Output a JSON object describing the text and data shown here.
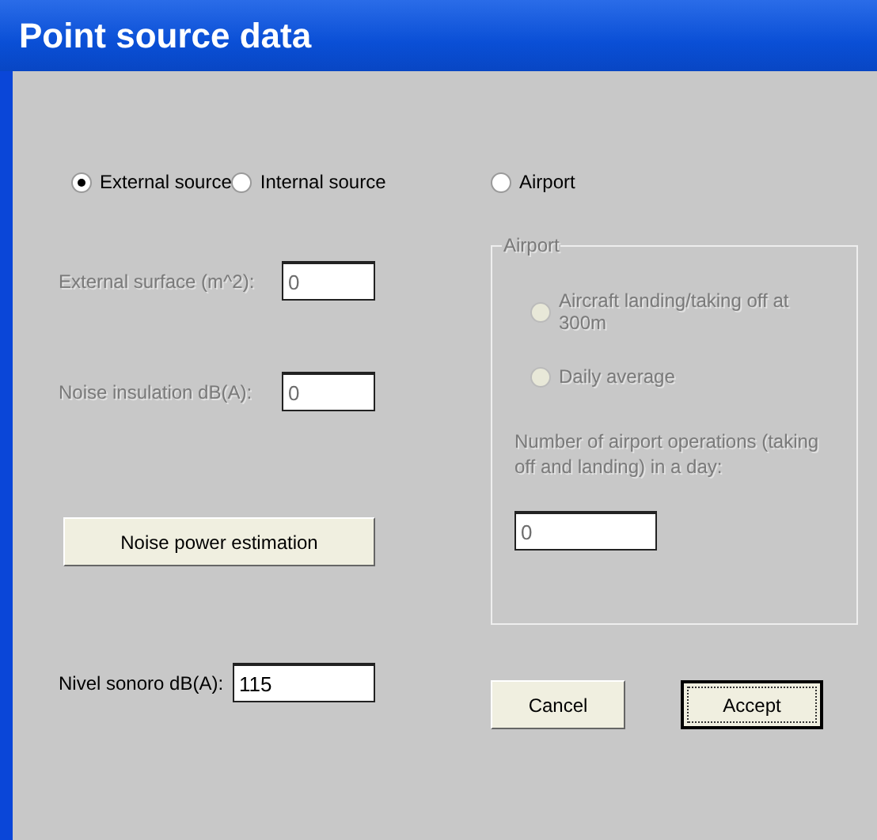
{
  "window": {
    "title": "Point source data"
  },
  "source_options": [
    {
      "label": "External source",
      "selected": true
    },
    {
      "label": "Internal source",
      "selected": false
    },
    {
      "label": "Airport",
      "selected": false
    }
  ],
  "fields": [
    {
      "label": "External surface (m^2):",
      "value": "0",
      "disabled": true
    },
    {
      "label": "Noise insulation dB(A):",
      "value": "0",
      "disabled": true
    }
  ],
  "estimate_button": "Noise power estimation",
  "sound_level": {
    "label": "Nivel sonoro dB(A):",
    "value": "115"
  },
  "airport_group": {
    "title": "Airport",
    "disabled": true,
    "options": [
      {
        "label": "Aircraft landing/taking off at 300m",
        "selected": false
      },
      {
        "label": "Daily average",
        "selected": false
      }
    ],
    "operations_label": "Number of airport operations (taking off and landing) in a day:",
    "operations_value": "0"
  },
  "buttons": [
    {
      "label": "Cancel",
      "default": false
    },
    {
      "label": "Accept",
      "default": true
    }
  ]
}
